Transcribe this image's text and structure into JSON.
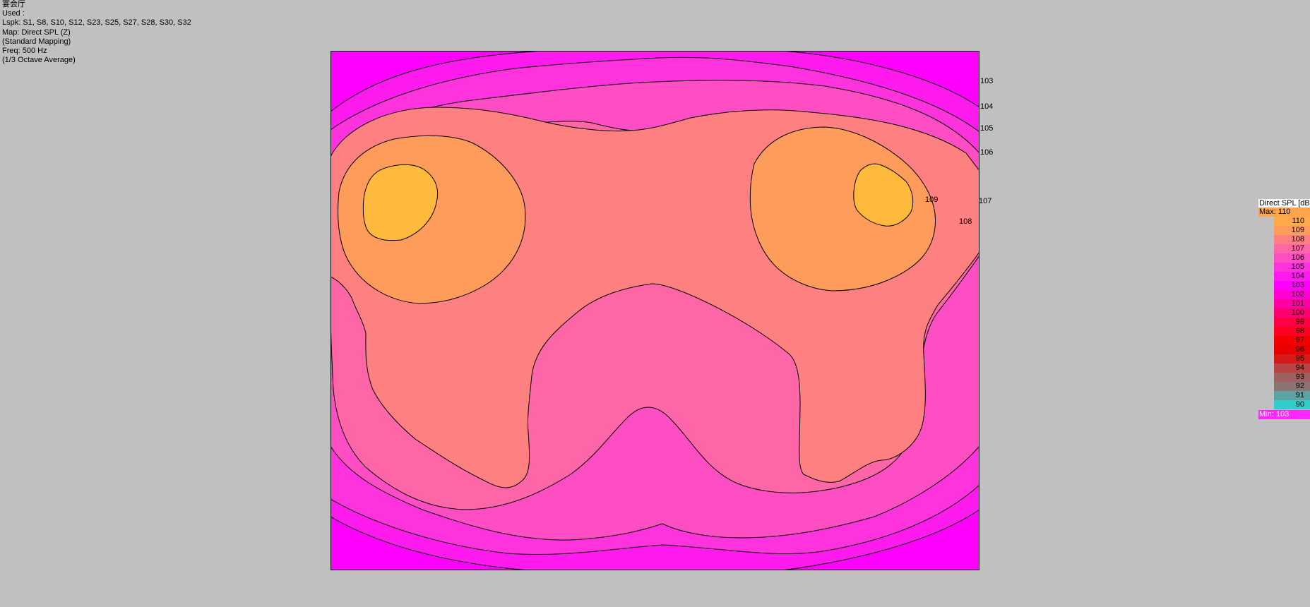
{
  "info": {
    "room": "宴会厅",
    "used_label": "Used :",
    "lspk": "Lspk: S1, S8, S10, S12, S23, S25, S27, S28, S30, S32",
    "map": "Map: Direct SPL (Z)",
    "mapping": "(Standard Mapping)",
    "freq": "Freq: 500 Hz",
    "averaging": "(1/3 Octave Average)"
  },
  "contour_labels": [
    "103",
    "104",
    "105",
    "106",
    "107",
    "108",
    "109"
  ],
  "legend": {
    "title": "Direct SPL [dB]",
    "max_label": "Max:  110",
    "min_label": "Min:  103",
    "max_color": "#ffa64d",
    "min_color": "#ff26ff",
    "levels": [
      {
        "value": "110",
        "color": "#ffa94d"
      },
      {
        "value": "109",
        "color": "#ff9c5c"
      },
      {
        "value": "108",
        "color": "#ff8080"
      },
      {
        "value": "107",
        "color": "#ff66a8"
      },
      {
        "value": "106",
        "color": "#ff4dc4"
      },
      {
        "value": "105",
        "color": "#ff33dd"
      },
      {
        "value": "104",
        "color": "#ff1aee"
      },
      {
        "value": "103",
        "color": "#ff00ff"
      },
      {
        "value": "102",
        "color": "#ff00d0"
      },
      {
        "value": "101",
        "color": "#ff00a0"
      },
      {
        "value": "100",
        "color": "#ff0070"
      },
      {
        "value": "99",
        "color": "#ff0044"
      },
      {
        "value": "98",
        "color": "#ff0022"
      },
      {
        "value": "97",
        "color": "#f20000"
      },
      {
        "value": "96",
        "color": "#e60000"
      },
      {
        "value": "95",
        "color": "#d61a1a"
      },
      {
        "value": "94",
        "color": "#b84545"
      },
      {
        "value": "93",
        "color": "#a06060"
      },
      {
        "value": "92",
        "color": "#8c7373"
      },
      {
        "value": "91",
        "color": "#5ea3a3"
      },
      {
        "value": "90",
        "color": "#33cccc"
      }
    ]
  },
  "colors": {
    "background": "#c0c0c0",
    "zone_103": "#ff00ff",
    "zone_104": "#ff1aee",
    "zone_105": "#ff33dd",
    "zone_106": "#ff4dc4",
    "zone_107": "#ff66a8",
    "zone_108": "#ff8080",
    "zone_109": "#ff9c5c",
    "zone_110": "#ffb93c"
  }
}
